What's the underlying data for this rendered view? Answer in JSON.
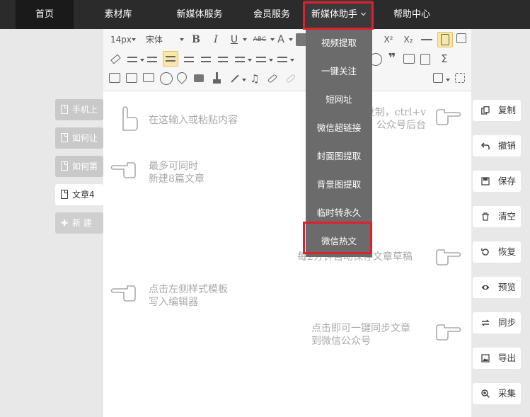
{
  "nav": {
    "items": [
      "首页",
      "素材库",
      "新媒体服务",
      "会员服务",
      "新媒体助手",
      "帮助中心"
    ]
  },
  "left": {
    "items": [
      "手机上",
      "如何让",
      "如何第",
      "文章4"
    ],
    "new_label": "新 建"
  },
  "toolbar": {
    "font_size": "14px",
    "font_family": "宋体",
    "bold": "B",
    "italic": "I",
    "underline": "U",
    "strike": "ABC",
    "fontcolor": "A",
    "superscript": "X²",
    "subscript": "X₂",
    "omega": "Ω"
  },
  "hints": {
    "paste": "在这输入或粘贴内容",
    "max_line1": "最多可同时",
    "max_line2": "新建8篇文章",
    "template_line1": "点击左侧样式模板",
    "template_line2": "写入编辑器",
    "copy_line1": "点击复制，ctrl+v",
    "copy_line2": "公众号后台",
    "autosave": "每2分钟自动保存文章草稿",
    "sync_line1": "点击即可一键同步文章",
    "sync_line2": "到微信公众号"
  },
  "dropdown": {
    "items": [
      "视频提取",
      "一键关注",
      "短网址",
      "微信超链接",
      "封面图提取",
      "背景图提取",
      "临时转永久",
      "微信热文"
    ]
  },
  "actions": [
    "复制",
    "撤销",
    "保存",
    "清空",
    "恢复",
    "预览",
    "同步",
    "导出",
    "采集"
  ]
}
